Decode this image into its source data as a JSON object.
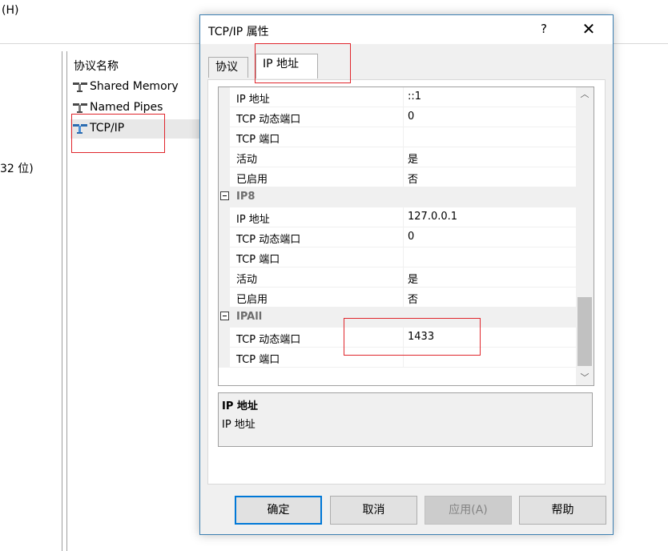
{
  "menu": {
    "help": "(H)"
  },
  "left_pane": {
    "text": "32 位)"
  },
  "list": {
    "column_header": "协议名称",
    "rows": [
      {
        "label": "Shared Memory"
      },
      {
        "label": "Named Pipes"
      },
      {
        "label": "TCP/IP"
      }
    ]
  },
  "dialog": {
    "title": "TCP/IP 属性",
    "help": "?",
    "close": "✕",
    "tabs": [
      {
        "label": "协议"
      },
      {
        "label": "IP 地址"
      }
    ],
    "grid": [
      {
        "key": "IP 地址",
        "value": "::1"
      },
      {
        "key": "TCP 动态端口",
        "value": "0"
      },
      {
        "key": "TCP 端口",
        "value": ""
      },
      {
        "key": "活动",
        "value": "是"
      },
      {
        "key": "已启用",
        "value": "否"
      },
      {
        "category": "IP8"
      },
      {
        "key": "IP 地址",
        "value": "127.0.0.1"
      },
      {
        "key": "TCP 动态端口",
        "value": "0"
      },
      {
        "key": "TCP 端口",
        "value": ""
      },
      {
        "key": "活动",
        "value": "是"
      },
      {
        "key": "已启用",
        "value": "否"
      },
      {
        "category": "IPAll"
      },
      {
        "key": "TCP 动态端口",
        "value": "1433"
      },
      {
        "key": "TCP 端口",
        "value": ""
      }
    ],
    "description": {
      "title": "IP 地址",
      "text": "IP 地址"
    },
    "buttons": {
      "ok": "确定",
      "cancel": "取消",
      "apply": "应用(A)",
      "help": "帮助"
    }
  },
  "colors": {
    "highlight_box": "#e0262c",
    "accent": "#0078d7"
  }
}
